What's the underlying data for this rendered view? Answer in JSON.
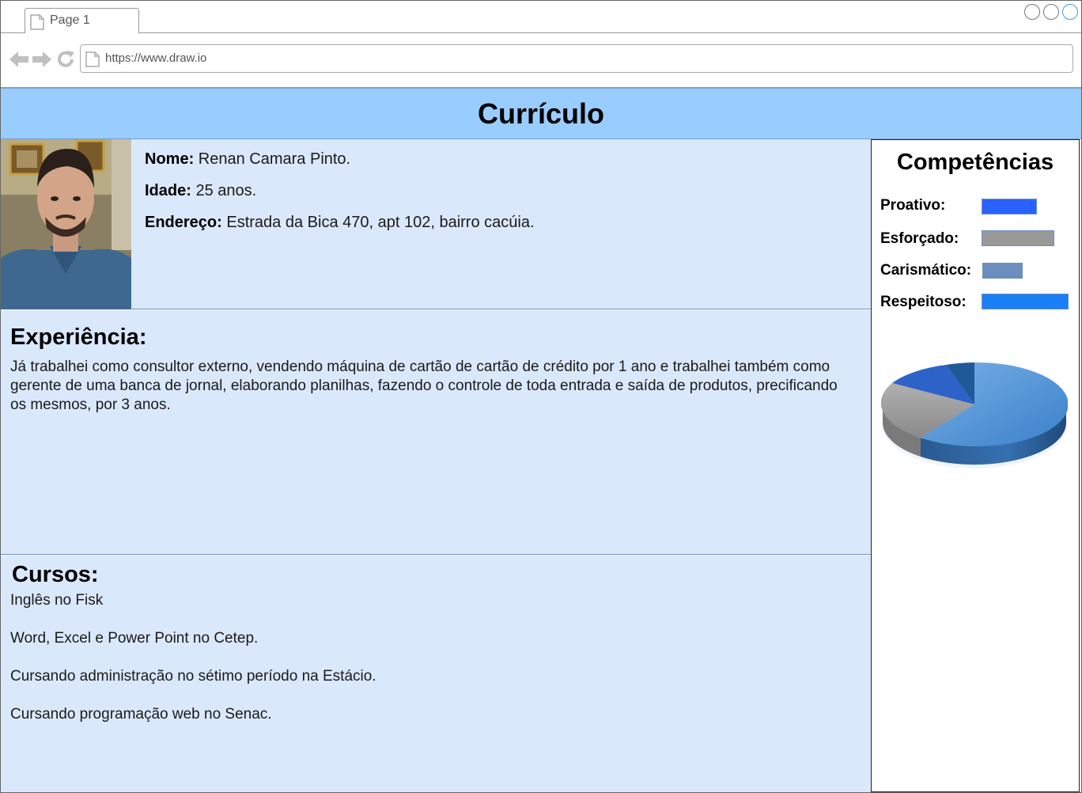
{
  "browser": {
    "tab_label": "Page 1",
    "url": "https://www.draw.io"
  },
  "header": {
    "title": "Currículo"
  },
  "profile": {
    "name_label": "Nome:",
    "name_value": " Renan Camara Pinto.",
    "age_label": "Idade:",
    "age_value": " 25 anos.",
    "address_label": "Endereço:",
    "address_value": " Estrada da Bica 470, apt 102, bairro cacúia."
  },
  "experience": {
    "title": "Experiência:",
    "text": "Já trabalhei como consultor externo, vendendo máquina de cartão de cartão de crédito por 1 ano e trabalhei também como gerente de uma banca de jornal, elaborando planilhas, fazendo o controle de toda entrada e saída de produtos, precificando os mesmos, por 3 anos."
  },
  "courses": {
    "title": "Cursos:",
    "items": [
      "Inglês no Fisk",
      "Word, Excel e Power Point no Cetep.",
      "Cursando administração no sétimo período na Estácio.",
      "Cursando programação web no Senac."
    ]
  },
  "skills": {
    "title": "Competências",
    "items": [
      {
        "label": "Proativo:",
        "level": 0.32,
        "color": "#2962ff"
      },
      {
        "label": "Esforçado:",
        "level": 0.42,
        "color": "#999999"
      },
      {
        "label": "Carismático:",
        "level": 0.23,
        "color": "#6c8ebf"
      },
      {
        "label": "Respeitoso:",
        "level": 0.5,
        "color": "#1a7ff5"
      }
    ]
  }
}
